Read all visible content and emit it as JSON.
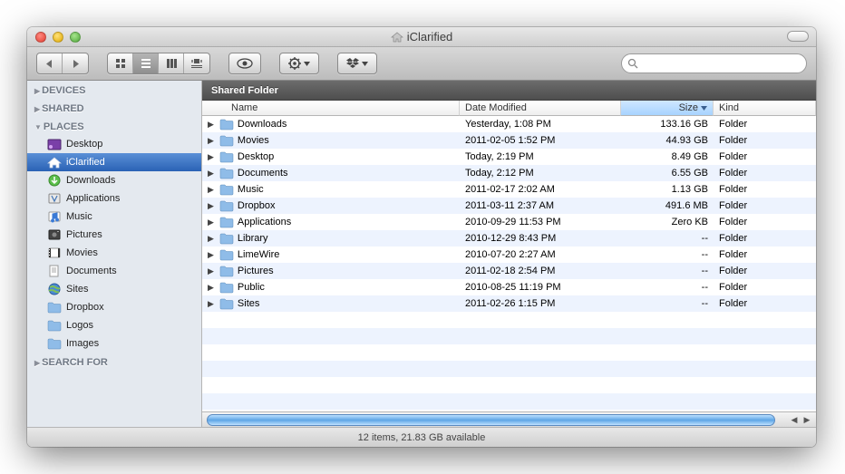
{
  "title": "iClarified",
  "shared_label": "Shared Folder",
  "search": {
    "placeholder": ""
  },
  "sidebar": {
    "sections": [
      {
        "label": "DEVICES",
        "expanded": false,
        "items": []
      },
      {
        "label": "SHARED",
        "expanded": false,
        "items": []
      },
      {
        "label": "PLACES",
        "expanded": true,
        "items": [
          {
            "label": "Desktop",
            "icon": "desktop",
            "selected": false
          },
          {
            "label": "iClarified",
            "icon": "home",
            "selected": true
          },
          {
            "label": "Downloads",
            "icon": "downloads",
            "selected": false
          },
          {
            "label": "Applications",
            "icon": "applications",
            "selected": false
          },
          {
            "label": "Music",
            "icon": "music",
            "selected": false
          },
          {
            "label": "Pictures",
            "icon": "pictures",
            "selected": false
          },
          {
            "label": "Movies",
            "icon": "movies",
            "selected": false
          },
          {
            "label": "Documents",
            "icon": "documents",
            "selected": false
          },
          {
            "label": "Sites",
            "icon": "sites",
            "selected": false
          },
          {
            "label": "Dropbox",
            "icon": "folder",
            "selected": false
          },
          {
            "label": "Logos",
            "icon": "folder",
            "selected": false
          },
          {
            "label": "Images",
            "icon": "folder",
            "selected": false
          }
        ]
      },
      {
        "label": "SEARCH FOR",
        "expanded": false,
        "items": []
      }
    ]
  },
  "columns": {
    "name": "Name",
    "date": "Date Modified",
    "size": "Size",
    "kind": "Kind",
    "sort_column": "size",
    "sort_dir": "desc"
  },
  "rows": [
    {
      "name": "Downloads",
      "date": "Yesterday, 1:08 PM",
      "size": "133.16 GB",
      "kind": "Folder"
    },
    {
      "name": "Movies",
      "date": "2011-02-05 1:52 PM",
      "size": "44.93 GB",
      "kind": "Folder"
    },
    {
      "name": "Desktop",
      "date": "Today, 2:19 PM",
      "size": "8.49 GB",
      "kind": "Folder"
    },
    {
      "name": "Documents",
      "date": "Today, 2:12 PM",
      "size": "6.55 GB",
      "kind": "Folder"
    },
    {
      "name": "Music",
      "date": "2011-02-17 2:02 AM",
      "size": "1.13 GB",
      "kind": "Folder"
    },
    {
      "name": "Dropbox",
      "date": "2011-03-11 2:37 AM",
      "size": "491.6 MB",
      "kind": "Folder"
    },
    {
      "name": "Applications",
      "date": "2010-09-29 11:53 PM",
      "size": "Zero KB",
      "kind": "Folder"
    },
    {
      "name": "Library",
      "date": "2010-12-29 8:43 PM",
      "size": "--",
      "kind": "Folder"
    },
    {
      "name": "LimeWire",
      "date": "2010-07-20 2:27 AM",
      "size": "--",
      "kind": "Folder"
    },
    {
      "name": "Pictures",
      "date": "2011-02-18 2:54 PM",
      "size": "--",
      "kind": "Folder"
    },
    {
      "name": "Public",
      "date": "2010-08-25 11:19 PM",
      "size": "--",
      "kind": "Folder"
    },
    {
      "name": "Sites",
      "date": "2011-02-26 1:15 PM",
      "size": "--",
      "kind": "Folder"
    }
  ],
  "status": "12 items, 21.83 GB available"
}
